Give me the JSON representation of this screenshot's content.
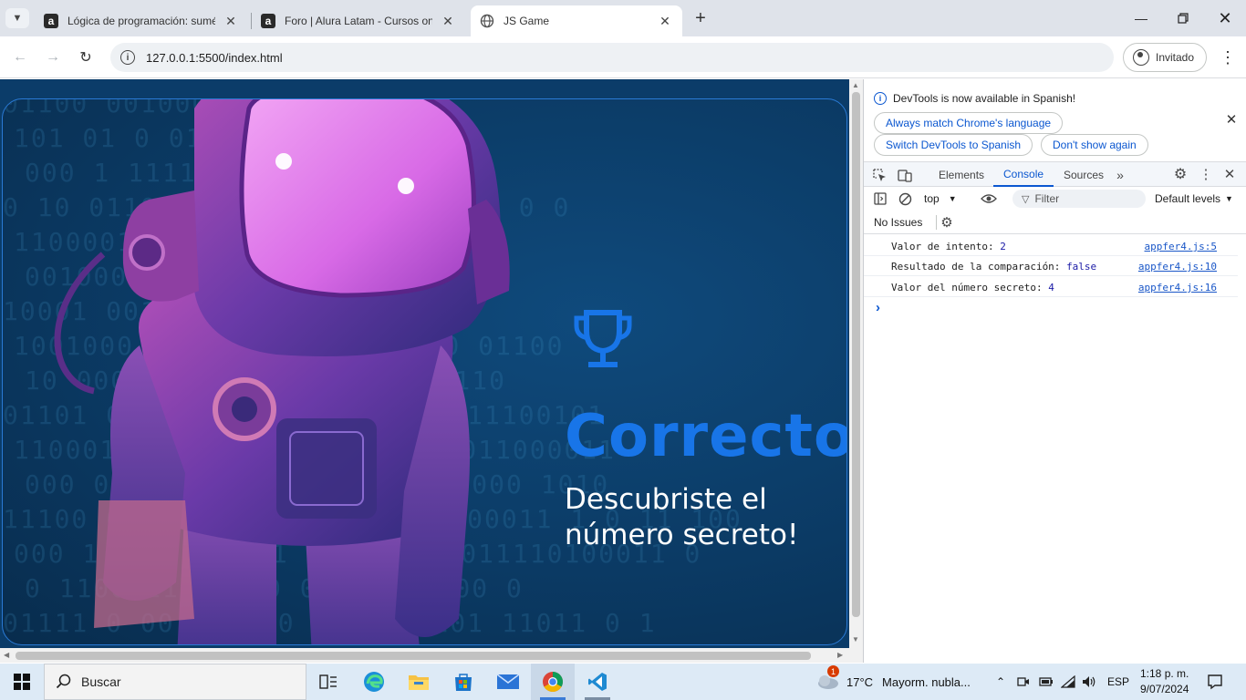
{
  "browser": {
    "tabs": [
      {
        "favicon": "a",
        "title": "Lógica de programación: sumé",
        "active": false
      },
      {
        "favicon": "a",
        "title": "Foro | Alura Latam - Cursos onl",
        "active": false
      },
      {
        "favicon": "globe-icon",
        "title": "JS Game",
        "active": true
      }
    ],
    "url": "127.0.0.1:5500/index.html",
    "profile_label": "Invitado"
  },
  "page": {
    "title": "Correcto!",
    "subtitle": "Descubriste el número secreto!",
    "binary_rows": [
      "01100    001000100000000 10",
      "    101 01 0  011  0011011 1 0",
      "     000 1     1111   1011010001",
      "0 10  0110 0  10101  110000011 1 0 0",
      "110000101 1 1 11 101    001011",
      "00100001  0 0   1111   1 1 0 1 0",
      "10001 001    10 0   1 1   0 0 1101",
      "1001000  01   11  1 0   11011010 01100",
      "10 0000 0    10 0  0101111011110",
      "01101   00  10 11 00  01000010 11100101",
      "110001 0 000  10 1    00101100011000011",
      "000  0 01 1  1    1  01000010111000 1010",
      "11100  0  0  00 100 1011 10 0000011 1 0 11 100",
      "000 1   0 1  1  1 01  01 110000011110100011 0",
      "0  1100 11 0 1  0   01000010 00  0",
      "01111  0 00 1 1  00 110 000101 11011 0 1"
    ]
  },
  "devtools": {
    "banner_text": "DevTools is now available in Spanish!",
    "banner_buttons": [
      "Always match Chrome's language",
      "Switch DevTools to Spanish",
      "Don't show again"
    ],
    "tabs": [
      "Elements",
      "Console",
      "Sources"
    ],
    "active_tab": "Console",
    "context": "top",
    "filter_placeholder": "Filter",
    "levels": "Default levels",
    "issues": "No Issues",
    "logs": [
      {
        "label": "Valor de intento: ",
        "value": "2",
        "source": "appfer4.js:5"
      },
      {
        "label": "Resultado de la comparación: ",
        "value": "false",
        "source": "appfer4.js:10"
      },
      {
        "label": "Valor del número secreto: ",
        "value": "4",
        "source": "appfer4.js:16"
      }
    ],
    "prompt": "›"
  },
  "taskbar": {
    "search_label": "Buscar",
    "weather_temp": "17°C",
    "weather_text": "Mayorm. nubla...",
    "weather_badge": "1",
    "language": "ESP",
    "time": "1:18 p. m.",
    "date": "9/07/2024"
  },
  "colors": {
    "accent": "#1875e8",
    "page_bg": "#0b3c69",
    "link": "#0b57d0"
  }
}
